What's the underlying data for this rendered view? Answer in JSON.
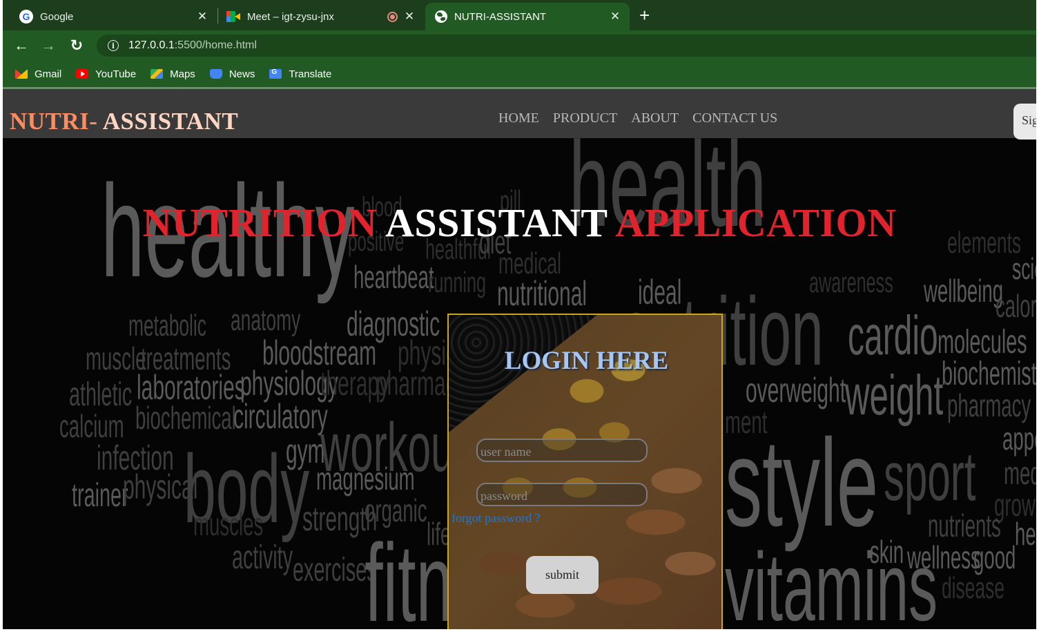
{
  "browser": {
    "tabs": [
      {
        "title": "Google",
        "icon": "google-icon"
      },
      {
        "title": "Meet – igt-zysu-jnx",
        "icon": "meet-icon"
      },
      {
        "title": "NUTRI-ASSISTANT",
        "icon": "globe-icon",
        "active": true
      }
    ],
    "close_glyph": "✕",
    "new_tab_glyph": "+",
    "url_host": "127.0.0.1",
    "url_rest": ":5500/home.html",
    "bookmarks": [
      {
        "label": "Gmail",
        "icon": "gmail-icon"
      },
      {
        "label": "YouTube",
        "icon": "youtube-icon"
      },
      {
        "label": "Maps",
        "icon": "maps-icon"
      },
      {
        "label": "News",
        "icon": "news-icon"
      },
      {
        "label": "Translate",
        "icon": "translate-icon"
      }
    ],
    "colors": {
      "frame": "#1c3e1d",
      "toolbar": "#215a23"
    }
  },
  "site": {
    "brand_part1": "NUTRI-",
    "brand_part2": " ASSISTANT",
    "nav": [
      "HOME",
      "PRODUCT",
      "ABOUT",
      "CONTACT US"
    ],
    "signin_label": "Sig",
    "hero": {
      "word1": "NUTRITION",
      "word2": " ASSISTANT ",
      "word3": "APPLICATION"
    },
    "background_words": [
      "healthy",
      "health",
      "nutrition",
      "blood",
      "pill",
      "positive",
      "healthful",
      "diet",
      "heartbeat",
      "medical",
      "running",
      "nutritional",
      "ideal",
      "awareness",
      "elements",
      "wellbeing",
      "scie",
      "caloric",
      "metabolic",
      "anatomy",
      "diagnostic",
      "cardio",
      "molecules",
      "muscle",
      "treatments",
      "bloodstream",
      "physic",
      "biochemistry",
      "athletic",
      "laboratories",
      "physiology",
      "therapy",
      "pharmacy",
      "overweight",
      "weight",
      "pharmacy",
      "calcium",
      "biochemical",
      "circulatory",
      "ment",
      "appe",
      "infection",
      "gym",
      "workout",
      "style",
      "sport",
      "medi",
      "body",
      "magnesium",
      "growth",
      "trainer",
      "physical",
      "organic",
      "nutrients",
      "hea",
      "muscles",
      "strength",
      "life",
      "skin",
      "wellness",
      "good",
      "activity",
      "exercises",
      "fitn",
      "vitamins",
      "disease"
    ],
    "login": {
      "title": "LOGIN HERE",
      "username_placeholder": "user name",
      "password_placeholder": "password",
      "forgot_label": "forgot password ?",
      "submit_label": "submit"
    },
    "colors": {
      "header": "#3a3a3a",
      "brand": "#ff8c61",
      "hero_red": "#e0232d",
      "login_title": "#a7c7f2",
      "link": "#1a76e0"
    }
  }
}
